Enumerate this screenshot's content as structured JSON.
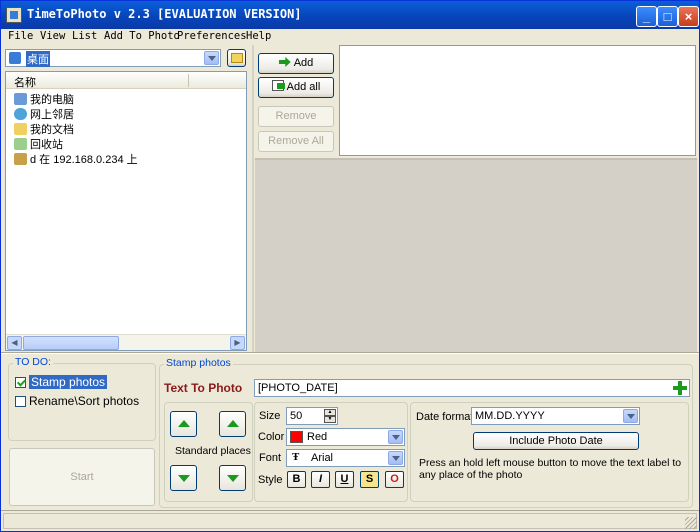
{
  "window": {
    "title": "TimeToPhoto v 2.3 [EVALUATION VERSION]"
  },
  "menu": [
    "File",
    "View",
    "List",
    "Add To Photo",
    "Preferences",
    "Help"
  ],
  "folder_combo": {
    "value": "桌面"
  },
  "tree": {
    "header": "名称",
    "items": [
      "我的电脑",
      "网上邻居",
      "我的文档",
      "回收站",
      "d 在 192.168.0.234 上"
    ]
  },
  "buttons": {
    "add": "Add",
    "add_all": "Add all",
    "remove": "Remove",
    "remove_all": "Remove All",
    "start": "Start"
  },
  "todo": {
    "label": "TO DO:",
    "items": [
      {
        "label": "Stamp photos",
        "checked": true
      },
      {
        "label": "Rename\\Sort photos",
        "checked": false
      }
    ]
  },
  "stamp": {
    "group_label": "Stamp photos",
    "text_label": "Text To Photo",
    "text_value": "[PHOTO_DATE]",
    "standard_places": "Standard places",
    "size_label": "Size",
    "size_value": "50",
    "color_label": "Color",
    "color_value": "Red",
    "color_swatch": "#ff0000",
    "font_label": "Font",
    "font_value": "Arial",
    "style_label": "Style",
    "styles": [
      "B",
      "I",
      "U",
      "S",
      "O"
    ],
    "date_format_label": "Date format",
    "date_format_value": "MM.DD.YYYY",
    "include_date": "Include Photo Date",
    "hint": "Press an hold left mouse button to move the text label to any place of the photo"
  }
}
